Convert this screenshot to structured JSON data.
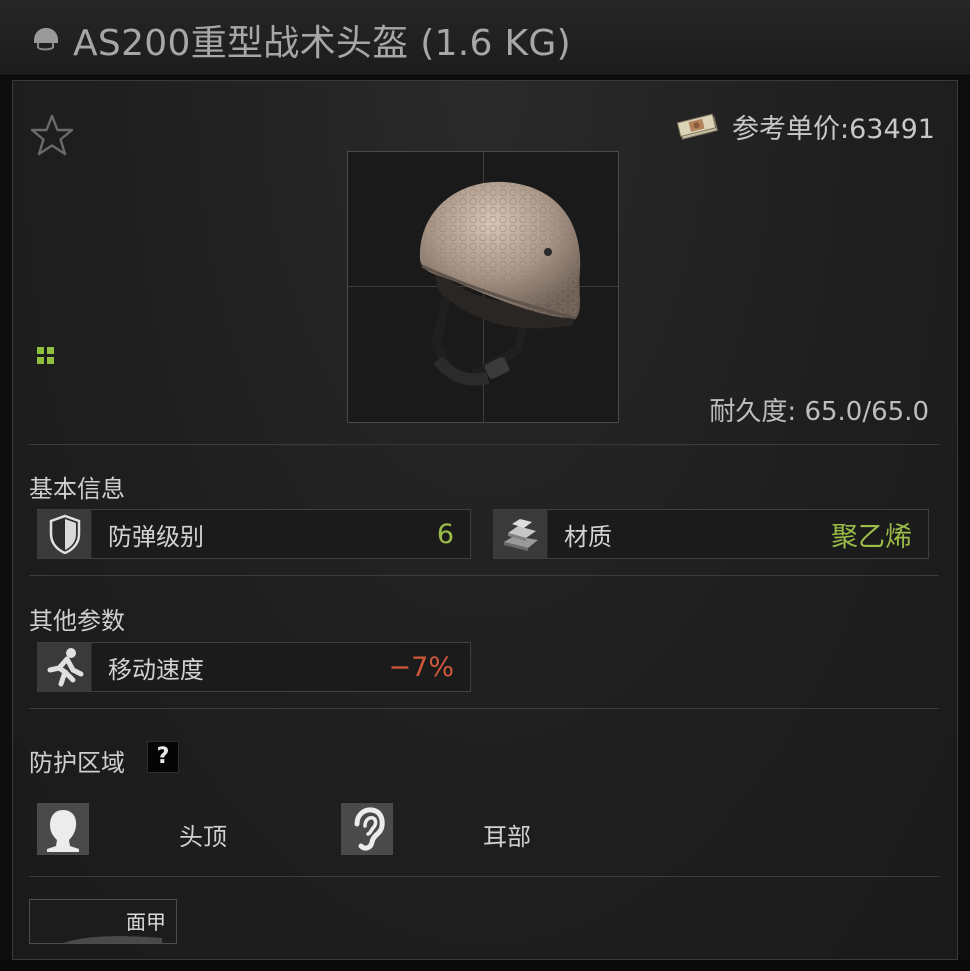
{
  "window": {
    "title": "AS200重型战术头盔 (1.6 KG)",
    "title_icon": "helmet-icon"
  },
  "item": {
    "favorite_icon": "star-outline-icon",
    "price_icon": "money-stack-icon",
    "price_text": "参考单价:63491",
    "image": "helmet-image",
    "durability_text": "耐久度: 65.0/65.0",
    "size_indicator_icon": "grid-squares-icon"
  },
  "sections": {
    "basic_info": {
      "title": "基本信息",
      "stats": [
        {
          "icon": "shield-icon",
          "label": "防弹级别",
          "value": "6",
          "value_color": "#9bbc48"
        },
        {
          "icon": "ingots-icon",
          "label": "材质",
          "value": "聚乙烯",
          "value_color": "#9bbc48"
        }
      ]
    },
    "other_params": {
      "title": "其他参数",
      "stats": [
        {
          "icon": "running-man-icon",
          "label": "移动速度",
          "value": "−7%",
          "value_color": "#d0583a"
        }
      ]
    },
    "protection_zones": {
      "title": "防护区域",
      "help_label": "?",
      "zones": [
        {
          "icon": "head-silhouette-icon",
          "label": "头顶"
        },
        {
          "icon": "ear-icon",
          "label": "耳部"
        }
      ]
    },
    "attachments": {
      "slot_label": "面甲"
    }
  }
}
